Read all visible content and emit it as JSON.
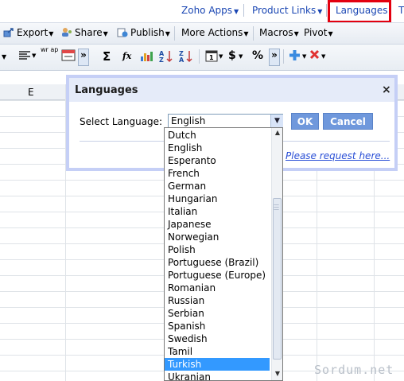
{
  "topbar": {
    "zoho_apps": "Zoho Apps",
    "product_links": "Product Links",
    "languages": "Languages",
    "cut_off": "T"
  },
  "toolbar": {
    "export": "Export",
    "share": "Share",
    "publish": "Publish",
    "more_actions": "More Actions",
    "macros": "Macros",
    "pivot": "Pivot",
    "wrap_label": "wr ap",
    "more_glyph": "»",
    "sum": "Σ",
    "fx": "fx",
    "dollar": "$",
    "percent": "%"
  },
  "sheet": {
    "column_e": "E"
  },
  "dialog": {
    "title": "Languages",
    "close": "×",
    "select_label": "Select Language:",
    "selected_value": "English",
    "ok": "OK",
    "cancel": "Cancel",
    "request_link": "Please request here..."
  },
  "dropdown": {
    "items": [
      "Dutch",
      "English",
      "Esperanto",
      "French",
      "German",
      "Hungarian",
      "Italian",
      "Japanese",
      "Norwegian",
      "Polish",
      "Portuguese (Brazil)",
      "Portuguese (Europe)",
      "Romanian",
      "Russian",
      "Serbian",
      "Spanish",
      "Swedish",
      "Tamil",
      "Turkish",
      "Ukranian"
    ],
    "selected": "Turkish"
  },
  "watermark": "Sordum.net",
  "colors": {
    "link": "#1a46b3",
    "highlight_border": "#e3000f",
    "dialog_border": "#c5cff6",
    "button": "#6f98dc",
    "selection": "#3399ff"
  }
}
